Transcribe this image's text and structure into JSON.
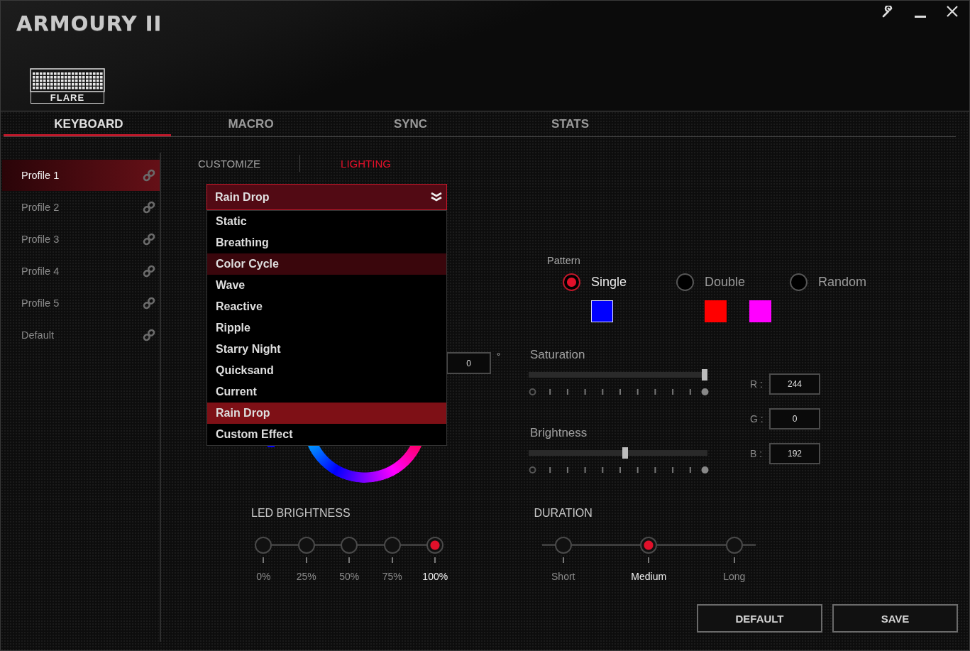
{
  "app": {
    "title": "ARMOURY II",
    "device_label": "FLARE"
  },
  "tabs": [
    {
      "label": "KEYBOARD",
      "selected": true
    },
    {
      "label": "MACRO",
      "selected": false
    },
    {
      "label": "SYNC",
      "selected": false
    },
    {
      "label": "STATS",
      "selected": false
    }
  ],
  "profiles": [
    {
      "label": "Profile 1",
      "selected": true
    },
    {
      "label": "Profile 2",
      "selected": false
    },
    {
      "label": "Profile 3",
      "selected": false
    },
    {
      "label": "Profile 4",
      "selected": false
    },
    {
      "label": "Profile 5",
      "selected": false
    },
    {
      "label": "Default",
      "selected": false
    }
  ],
  "subtabs": [
    {
      "label": "CUSTOMIZE",
      "selected": false
    },
    {
      "label": "LIGHTING",
      "selected": true
    }
  ],
  "effect_dropdown": {
    "value": "Rain Drop",
    "expanded": true,
    "options": [
      {
        "label": "Static",
        "hovered": false,
        "selected": false
      },
      {
        "label": "Breathing",
        "hovered": false,
        "selected": false
      },
      {
        "label": "Color Cycle",
        "hovered": true,
        "selected": false
      },
      {
        "label": "Wave",
        "hovered": false,
        "selected": false
      },
      {
        "label": "Reactive",
        "hovered": false,
        "selected": false
      },
      {
        "label": "Ripple",
        "hovered": false,
        "selected": false
      },
      {
        "label": "Starry Night",
        "hovered": false,
        "selected": false
      },
      {
        "label": "Quicksand",
        "hovered": false,
        "selected": false
      },
      {
        "label": "Current",
        "hovered": false,
        "selected": false
      },
      {
        "label": "Rain Drop",
        "hovered": false,
        "selected": true
      },
      {
        "label": "Custom Effect",
        "hovered": false,
        "selected": false
      }
    ]
  },
  "hue": {
    "value": "0",
    "unit": "°"
  },
  "pattern": {
    "label": "Pattern",
    "options": [
      {
        "label": "Single",
        "selected": true,
        "swatches": [
          {
            "color": "#0000ff",
            "selected": true
          }
        ]
      },
      {
        "label": "Double",
        "selected": false,
        "swatches": [
          {
            "color": "#ff0000",
            "selected": false
          },
          {
            "color": "#ff00ff",
            "selected": false
          }
        ]
      },
      {
        "label": "Random",
        "selected": false
      }
    ]
  },
  "sliders": [
    {
      "label": "Saturation",
      "level": 1.0
    },
    {
      "label": "Brightness",
      "level": 0.54
    }
  ],
  "rgb": [
    {
      "label": "R :",
      "value": "244"
    },
    {
      "label": "G :",
      "value": "0"
    },
    {
      "label": "B :",
      "value": "192"
    }
  ],
  "led_brightness": {
    "label": "LED BRIGHTNESS",
    "options": [
      {
        "label": "0%",
        "selected": false
      },
      {
        "label": "25%",
        "selected": false
      },
      {
        "label": "50%",
        "selected": false
      },
      {
        "label": "75%",
        "selected": false
      },
      {
        "label": "100%",
        "selected": true
      }
    ]
  },
  "duration": {
    "label": "DURATION",
    "options": [
      {
        "label": "Short",
        "selected": false
      },
      {
        "label": "Medium",
        "selected": true
      },
      {
        "label": "Long",
        "selected": false
      }
    ]
  },
  "buttons": [
    "DEFAULT",
    "SAVE"
  ]
}
